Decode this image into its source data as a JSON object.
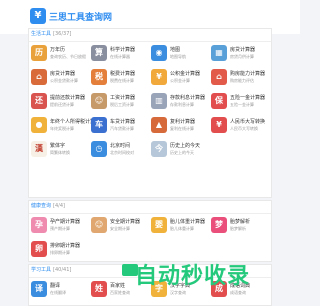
{
  "header": {
    "logo_glyph": "¥",
    "site_name": "三思工具查询网"
  },
  "sections": [
    {
      "title": "生活工具",
      "count": "[36/37]",
      "items": [
        {
          "name": "万年历",
          "desc": "查询农历、节日放假",
          "icon": "calendar-icon",
          "glyph": "历",
          "color": "#e9a23b"
        },
        {
          "name": "科学计算器",
          "desc": "在线计算器",
          "icon": "calculator-icon",
          "glyph": "算",
          "color": "#8a8fa0"
        },
        {
          "name": "地图",
          "desc": "地图导航",
          "icon": "map-pin-icon",
          "glyph": "◉",
          "color": "#3b8de0"
        },
        {
          "name": "房贷计算器",
          "desc": "房贷月供计算",
          "icon": "building-icon",
          "glyph": "▦",
          "color": "#5aa0d8"
        },
        {
          "name": "房贷计算器",
          "desc": "公积金贷款计算",
          "icon": "house-icon",
          "glyph": "⌂",
          "color": "#d96b3a"
        },
        {
          "name": "税费计算器",
          "desc": "税费在线计算",
          "icon": "tax-icon",
          "glyph": "税",
          "color": "#e37f3a"
        },
        {
          "name": "公积金计算器",
          "desc": "公积金计算",
          "icon": "money-bag-icon",
          "glyph": "¥",
          "color": "#f0a93a"
        },
        {
          "name": "购房能力计算器",
          "desc": "购房能力评估",
          "icon": "house-money-icon",
          "glyph": "⌂",
          "color": "#e25b4a"
        },
        {
          "name": "提前还款计算器",
          "desc": "提前还贷计算",
          "icon": "repay-icon",
          "glyph": "还",
          "color": "#d9534f"
        },
        {
          "name": "工资计算器",
          "desc": "税后工资计算",
          "icon": "worker-icon",
          "glyph": "☺",
          "color": "#c79a6a"
        },
        {
          "name": "存款利息计算器",
          "desc": "存款利息计算",
          "icon": "bank-icon",
          "glyph": "▥",
          "color": "#9aa4b8"
        },
        {
          "name": "五险一金计算器",
          "desc": "五险一金计算",
          "icon": "insurance-icon",
          "glyph": "保",
          "color": "#e24e4e"
        },
        {
          "name": "年终个人所得税计算器",
          "desc": "年终奖税计算",
          "icon": "coins-icon",
          "glyph": "●",
          "color": "#f0b23a"
        },
        {
          "name": "车贷计算器",
          "desc": "汽车贷款计算",
          "icon": "car-icon",
          "glyph": "车",
          "color": "#3b6fd0"
        },
        {
          "name": "复利计算器",
          "desc": "复利在线计算",
          "icon": "chart-icon",
          "glyph": "▲",
          "color": "#d66a3a"
        },
        {
          "name": "人民币大写转换",
          "desc": "人民币大写转换",
          "icon": "yuan-icon",
          "glyph": "¥",
          "color": "#e24e4e"
        },
        {
          "name": "繁体字",
          "desc": "简繁体转换",
          "icon": "chinese-char-icon",
          "glyph": "漢",
          "color": "#f7f0e6",
          "glyph_color": "#c0392b"
        },
        {
          "name": "北京时间",
          "desc": "北京时间校对",
          "icon": "clock-icon",
          "glyph": "◷",
          "color": "#3b8de0"
        },
        {
          "name": "历史上的今天",
          "desc": "历史上的今天",
          "icon": "history-icon",
          "glyph": "今",
          "color": "#b5c7d8"
        }
      ]
    },
    {
      "title": "健康查询",
      "count": "[4/4]",
      "items": [
        {
          "name": "孕产期计算器",
          "desc": "预产期计算",
          "icon": "pregnancy-icon",
          "glyph": "孕",
          "color": "#f08bb0"
        },
        {
          "name": "安全期计算器",
          "desc": "安全期计算",
          "icon": "nurse-icon",
          "glyph": "☺",
          "color": "#e0a870"
        },
        {
          "name": "胎儿体重计算器",
          "desc": "胎儿体重计算",
          "icon": "baby-icon",
          "glyph": "婴",
          "color": "#f0b23a"
        },
        {
          "name": "胎梦解析",
          "desc": "胎梦解析",
          "icon": "dream-icon",
          "glyph": "梦",
          "color": "#e94f7a"
        },
        {
          "name": "排卵期计算器",
          "desc": "排卵期计算",
          "icon": "ovulation-icon",
          "glyph": "卵",
          "color": "#e24e4e"
        }
      ]
    },
    {
      "title": "学习工具",
      "count": "[40/41]",
      "items": [
        {
          "name": "翻译",
          "desc": "在线翻译",
          "icon": "translate-icon",
          "glyph": "译",
          "color": "#3b8de0"
        },
        {
          "name": "百家姓",
          "desc": "百家姓查询",
          "icon": "surname-icon",
          "glyph": "姓",
          "color": "#e24e4e"
        },
        {
          "name": "汉字字典",
          "desc": "汉字查询",
          "icon": "dictionary-icon",
          "glyph": "字",
          "color": "#f0b23a"
        },
        {
          "name": "成语词典",
          "desc": "成语查询",
          "icon": "idiom-icon",
          "glyph": "成",
          "color": "#e24e4e"
        }
      ]
    }
  ],
  "watermark": {
    "text": "自动秒收录"
  }
}
